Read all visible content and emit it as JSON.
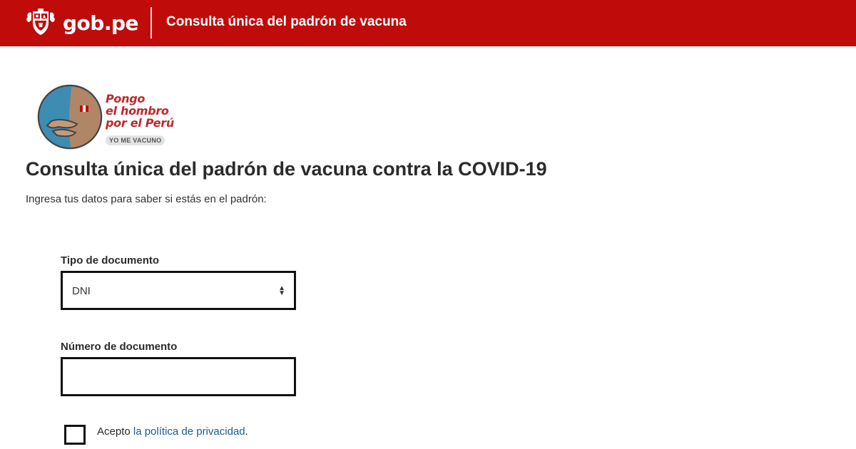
{
  "header": {
    "brand_text": "gob.pe",
    "title": "Consulta única del padrón de vacuna",
    "background_color": "#c00b0b",
    "shield_icon": "peru-coat-of-arms-icon"
  },
  "campaign": {
    "slogan_line1": "Pongo",
    "slogan_line2": "el hombro",
    "slogan_line3": "por el Perú",
    "tagline": "YO ME VACUNO",
    "icon": "vaccinated-shoulder-icon"
  },
  "main": {
    "title": "Consulta única del padrón de vacuna contra la COVID-19",
    "subtitle": "Ingresa tus datos para saber si estás en el padrón:"
  },
  "form": {
    "doc_type_label": "Tipo de documento",
    "doc_type_value": "DNI",
    "doc_number_label": "Número de documento",
    "doc_number_value": "",
    "accept_prefix": "Acepto ",
    "privacy_link": "la política de privacidad",
    "accept_suffix": ".",
    "privacy_accepted": false,
    "link_color": "#1f5a96"
  }
}
